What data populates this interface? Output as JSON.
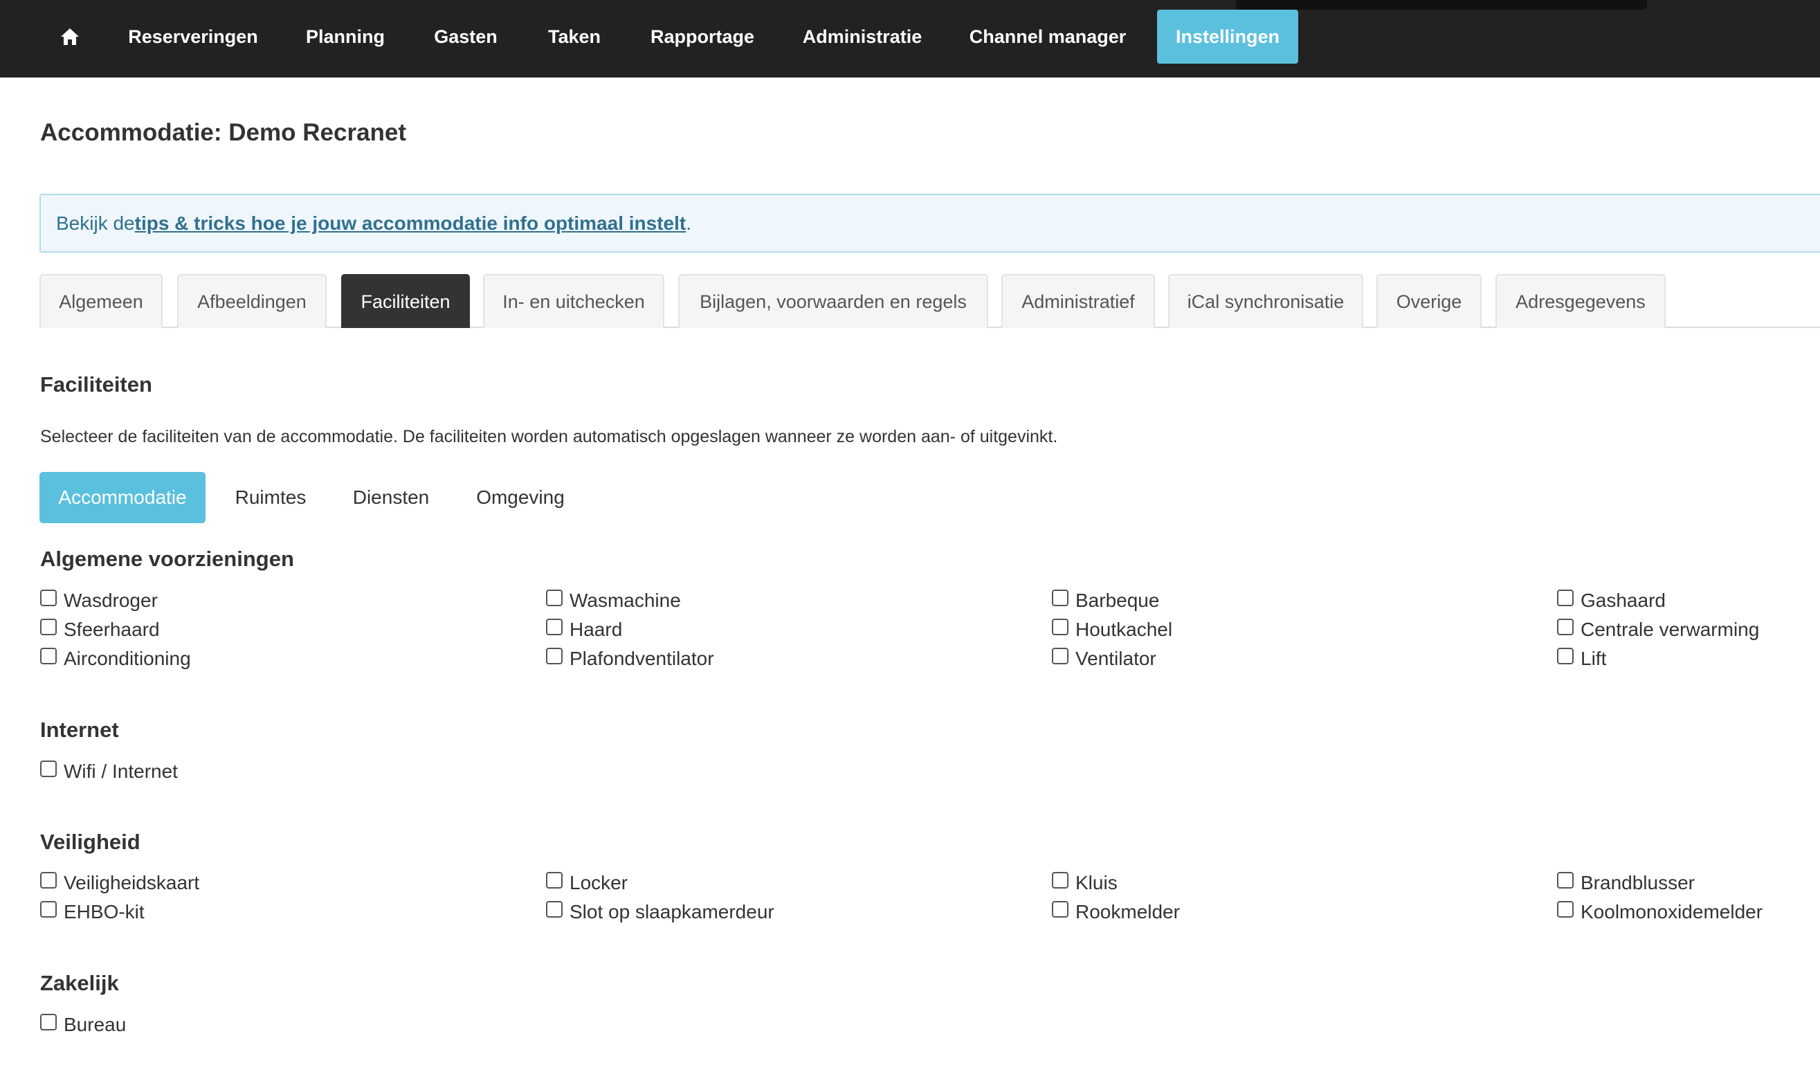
{
  "nav": {
    "home_icon": "home-icon",
    "items": [
      "Reserveringen",
      "Planning",
      "Gasten",
      "Taken",
      "Rapportage",
      "Administratie",
      "Channel manager",
      "Instellingen"
    ],
    "active": "Instellingen",
    "active_color": "#5bc0de",
    "bar_color": "#222222"
  },
  "page": {
    "title": "Accommodatie: Demo Recranet"
  },
  "info": {
    "prefix": "Bekijk de",
    "link": "tips & tricks hoe je jouw accommodatie info optimaal instelt",
    "suffix": "."
  },
  "tabs": {
    "items": [
      "Algemeen",
      "Afbeeldingen",
      "Faciliteiten",
      "In- en uitchecken",
      "Bijlagen, voorwaarden en regels",
      "Administratief",
      "iCal synchronisatie",
      "Overige",
      "Adresgegevens"
    ],
    "active": "Faciliteiten"
  },
  "facilities": {
    "heading": "Faciliteiten",
    "description": "Selecteer de faciliteiten van de accommodatie. De faciliteiten worden automatisch opgeslagen wanneer ze worden aan- of uitgevinkt.",
    "subtabs": [
      "Accommodatie",
      "Ruimtes",
      "Diensten",
      "Omgeving"
    ],
    "active_subtab": "Accommodatie"
  },
  "groups": [
    {
      "heading": "Algemene voorzieningen",
      "items": [
        {
          "label": "Wasdroger",
          "checked": false
        },
        {
          "label": "Wasmachine",
          "checked": false
        },
        {
          "label": "Barbeque",
          "checked": false
        },
        {
          "label": "Gashaard",
          "checked": false
        },
        {
          "label": "Sfeerhaard",
          "checked": false
        },
        {
          "label": "Haard",
          "checked": false
        },
        {
          "label": "Houtkachel",
          "checked": false
        },
        {
          "label": "Centrale verwarming",
          "checked": false
        },
        {
          "label": "Airconditioning",
          "checked": false
        },
        {
          "label": "Plafondventilator",
          "checked": false
        },
        {
          "label": "Ventilator",
          "checked": false
        },
        {
          "label": "Lift",
          "checked": false
        }
      ]
    },
    {
      "heading": "Internet",
      "items": [
        {
          "label": "Wifi / Internet",
          "checked": false
        }
      ]
    },
    {
      "heading": "Veiligheid",
      "items": [
        {
          "label": "Veiligheidskaart",
          "checked": false
        },
        {
          "label": "Locker",
          "checked": false
        },
        {
          "label": "Kluis",
          "checked": false
        },
        {
          "label": "Brandblusser",
          "checked": false
        },
        {
          "label": "EHBO-kit",
          "checked": false
        },
        {
          "label": "Slot op slaapkamerdeur",
          "checked": false
        },
        {
          "label": "Rookmelder",
          "checked": false
        },
        {
          "label": "Koolmonoxidemelder",
          "checked": false
        }
      ]
    },
    {
      "heading": "Zakelijk",
      "items": [
        {
          "label": "Bureau",
          "checked": false
        }
      ]
    }
  ]
}
